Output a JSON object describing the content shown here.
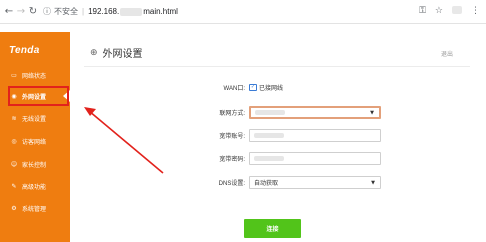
{
  "browser": {
    "security_label": "不安全",
    "url_host": "192.168.",
    "url_path": "main.html"
  },
  "sidebar": {
    "logo": "Tenda",
    "items": [
      {
        "label": "网络状态",
        "icon": "monitor-icon"
      },
      {
        "label": "外网设置",
        "icon": "globe-icon"
      },
      {
        "label": "无线设置",
        "icon": "wifi-icon"
      },
      {
        "label": "访客网络",
        "icon": "guest-icon"
      },
      {
        "label": "家长控制",
        "icon": "parental-icon"
      },
      {
        "label": "高级功能",
        "icon": "wrench-icon"
      },
      {
        "label": "系统管理",
        "icon": "gear-icon"
      }
    ],
    "active_item": "外网设置"
  },
  "header": {
    "title": "外网设置",
    "logout": "退出"
  },
  "form": {
    "wan_label": "WAN口:",
    "wan_status": "已接网线",
    "mode_label": "联网方式:",
    "account_label": "宽带账号:",
    "password_label": "宽带密码:",
    "dns_label": "DNS设置:",
    "dns_value": "自动获取",
    "connect_button": "连接"
  },
  "colors": {
    "sidebar": "#ef7d10",
    "button": "#52c41a",
    "annotation": "#e2221c"
  }
}
